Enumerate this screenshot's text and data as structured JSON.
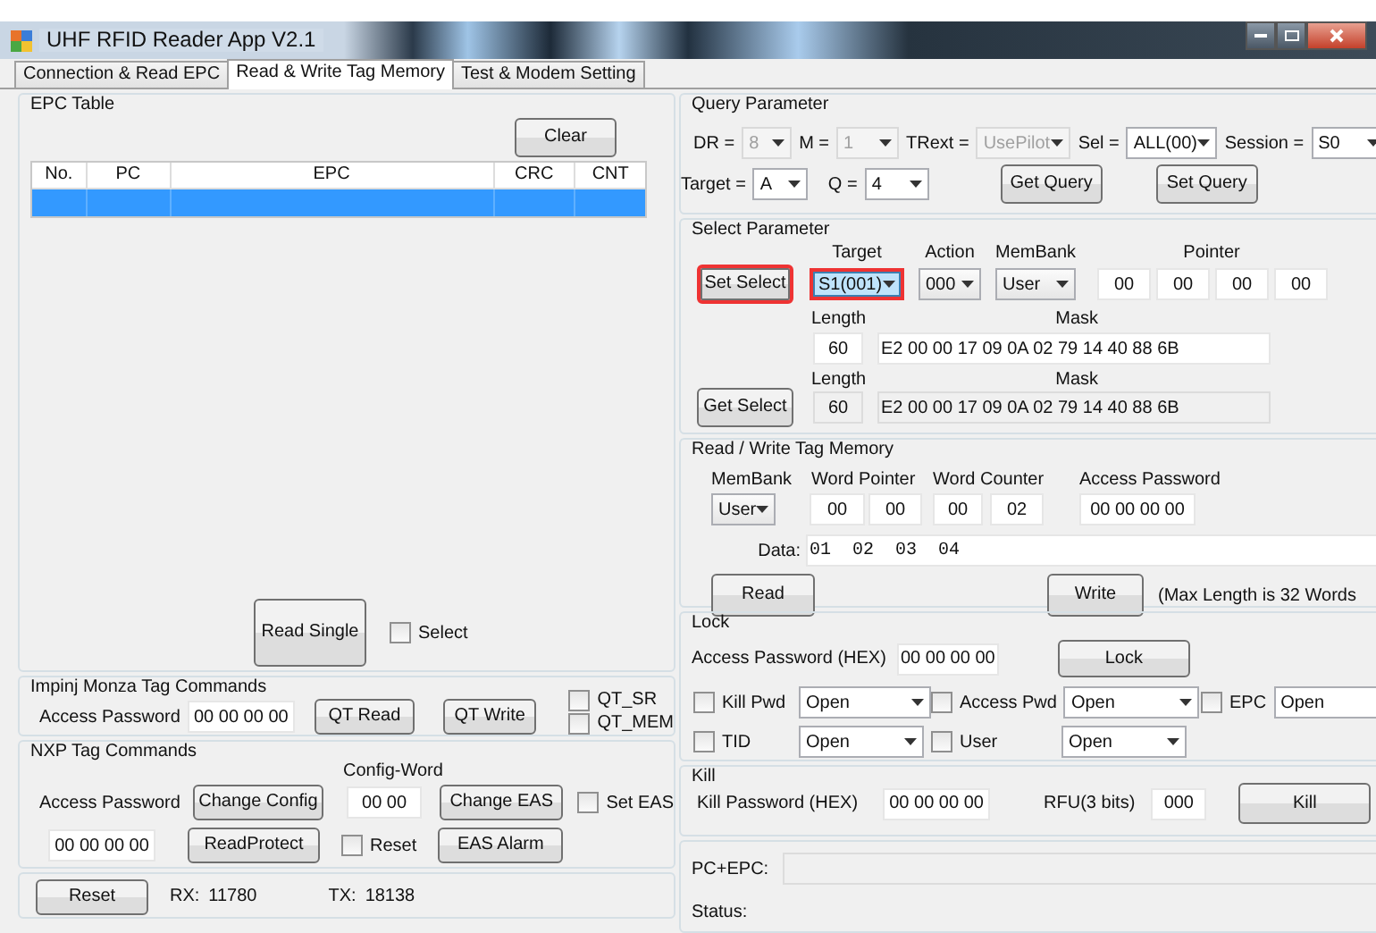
{
  "window": {
    "title": "UHF RFID Reader App V2.1"
  },
  "tabs": [
    {
      "label": "Connection & Read EPC",
      "selected": false
    },
    {
      "label": "Read & Write Tag Memory",
      "selected": true
    },
    {
      "label": "Test & Modem Setting",
      "selected": false
    }
  ],
  "epc_table": {
    "title": "EPC Table",
    "clear_button": "Clear",
    "columns": [
      "No.",
      "PC",
      "EPC",
      "CRC",
      "CNT"
    ],
    "rows": [
      {
        "selected": true
      }
    ]
  },
  "read_single": {
    "button": "Read Single",
    "select": {
      "label": "Select",
      "checked": false
    }
  },
  "impinj": {
    "title": "Impinj Monza Tag Commands",
    "access_password_label": "Access Password",
    "access_password": "00 00 00 00",
    "buttons": [
      "QT Read",
      "QT Write"
    ],
    "checkboxes": [
      {
        "label": "QT_SR",
        "checked": false
      },
      {
        "label": "QT_MEM",
        "checked": false
      }
    ]
  },
  "nxp": {
    "title": "NXP Tag Commands",
    "config_word_label": "Config-Word",
    "access_password_label": "Access Password",
    "change_config_button": "Change Config",
    "config_word": "00 00",
    "change_eas_button": "Change EAS",
    "set_eas": {
      "label": "Set EAS",
      "checked": false
    },
    "access_password": "00 00 00 00",
    "read_protect_button": "ReadProtect",
    "reset": {
      "label": "Reset",
      "checked": false
    },
    "eas_alarm_button": "EAS Alarm"
  },
  "status_bar": {
    "reset_button": "Reset",
    "rx_label": "RX:",
    "rx": "11780",
    "tx_label": "TX:",
    "tx": "18138"
  },
  "query_parameter": {
    "title": "Query Parameter",
    "row_1": [
      {
        "label": "DR =",
        "value": "8",
        "disabled": true
      },
      {
        "label": "M =",
        "value": "1",
        "disabled": true
      },
      {
        "label": "TRext =",
        "value": "UsePilot",
        "disabled": true
      },
      {
        "label": "Sel =",
        "value": "ALL(00)",
        "disabled": false
      },
      {
        "label": "Session =",
        "value": "S0",
        "disabled": false
      }
    ],
    "row_2": [
      {
        "label": "Target =",
        "value": "A",
        "disabled": false
      },
      {
        "label": "Q =",
        "value": "4",
        "disabled": false
      }
    ],
    "get_button": "Get Query",
    "set_button": "Set Query"
  },
  "select_parameter": {
    "title": "Select Parameter",
    "target_label": "Target",
    "action_label": "Action",
    "membank_label": "MemBank",
    "pointer_label": "Pointer",
    "set_button": {
      "label": "Set Select",
      "highlighted": true
    },
    "target": {
      "value": "S1(001)",
      "highlighted": true
    },
    "action": "000",
    "membank": "User",
    "pointer": [
      "00",
      "00",
      "00",
      "00"
    ],
    "length_label": "Length",
    "mask_label": "Mask",
    "length": "60",
    "mask": "E2 00 00 17 09 0A 02 79 14 40 88 6B",
    "get_length_label": "Length",
    "get_mask_label": "Mask",
    "get_button": "Get Select",
    "get_length": {
      "value": "60",
      "readonly": true
    },
    "get_mask": {
      "value": "E2 00 00 17 09 0A 02 79 14 40 88 6B",
      "readonly": true
    }
  },
  "read_write": {
    "title": "Read / Write Tag Memory",
    "membank_label": "MemBank",
    "word_pointer_label": "Word Pointer",
    "word_counter_label": "Word Counter",
    "access_password_label": "Access Password",
    "membank": "User",
    "word_pointer": [
      "00",
      "00"
    ],
    "word_counter": [
      "00",
      "02"
    ],
    "access_password": "00 00 00 00",
    "data_label": "Data:",
    "data": "01  02  03  04",
    "read_button": "Read",
    "write_button": "Write",
    "note": "(Max Length is 32 Words"
  },
  "lock": {
    "title": "Lock",
    "access_password_label": "Access Password (HEX)",
    "access_password": "00 00 00 00",
    "button": "Lock",
    "items": [
      {
        "label": "Kill Pwd",
        "checked": false,
        "value": "Open"
      },
      {
        "label": "Access Pwd",
        "checked": false,
        "value": "Open"
      },
      {
        "label": "EPC",
        "checked": false,
        "value": "Open"
      },
      {
        "label": "TID",
        "checked": false,
        "value": "Open"
      },
      {
        "label": "User",
        "checked": false,
        "value": "Open"
      }
    ]
  },
  "kill": {
    "title": "Kill",
    "password_label": "Kill Password (HEX)",
    "password": "00 00 00 00",
    "rfu_label": "RFU(3 bits)",
    "rfu": "000",
    "button": "Kill"
  },
  "result": {
    "pc_epc_label": "PC+EPC:",
    "status_label": "Status:"
  }
}
